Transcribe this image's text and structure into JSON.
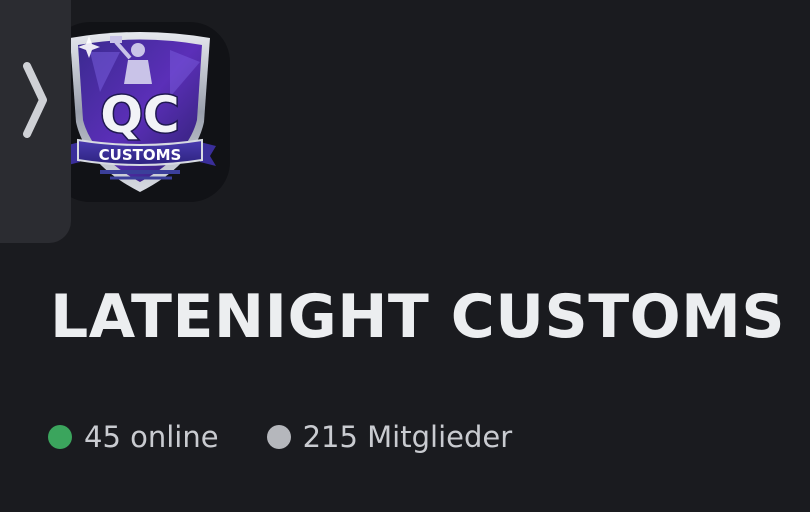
{
  "server": {
    "name": "LATENIGHT CUSTOMS",
    "icon": {
      "name": "qc-customs-shield-logo",
      "letters": "QC",
      "banner": "CUSTOMS"
    }
  },
  "side_panel": {
    "toggle_icon": "chevron-right-icon"
  },
  "stats": {
    "online": {
      "label": "45 online",
      "color": "#3ba55d"
    },
    "members": {
      "label": "215 Mitglieder",
      "color": "#b5b7bc"
    }
  }
}
